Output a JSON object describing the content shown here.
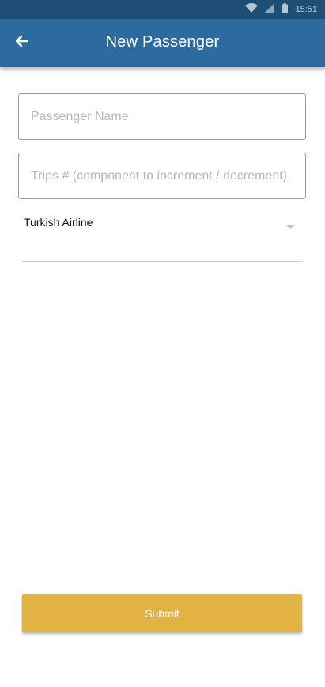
{
  "status_bar": {
    "time": "15:51",
    "icons": [
      "wifi-icon",
      "signal-icon",
      "battery-icon"
    ]
  },
  "app_bar": {
    "title": "New Passenger",
    "back_icon": "arrow-left-icon"
  },
  "form": {
    "passenger_name": {
      "value": "",
      "placeholder": "Passenger Name"
    },
    "trips": {
      "value": "",
      "placeholder": "Trips # (component to increment / decrement)"
    },
    "airline": {
      "selected": "Turkish Airline",
      "caret_icon": "caret-down-icon"
    },
    "submit_label": "Submit"
  },
  "colors": {
    "status_bar": "#1f4e74",
    "app_bar": "#2d6b9e",
    "submit_button": "#e0b343",
    "field_border": "#9a9a9a",
    "placeholder": "#b8b8b8"
  }
}
